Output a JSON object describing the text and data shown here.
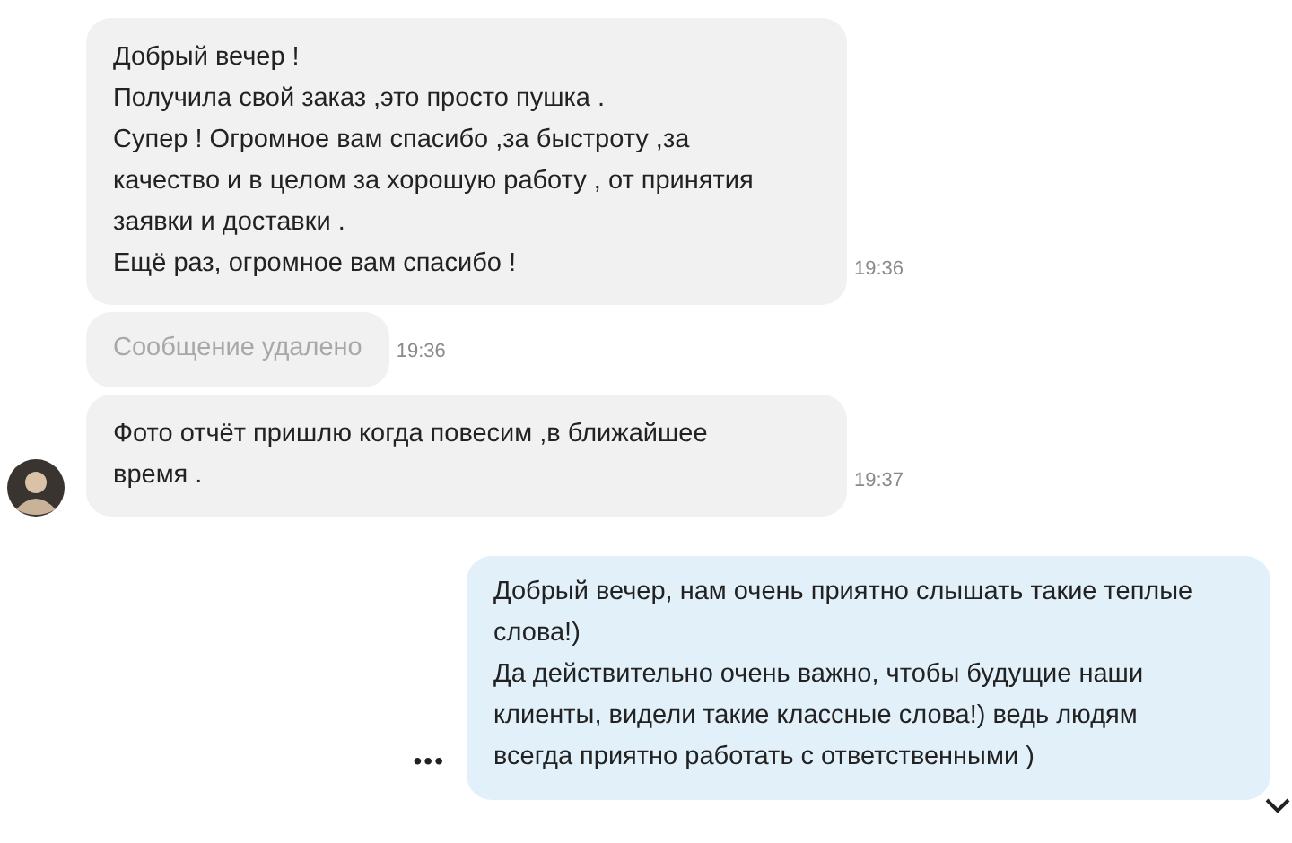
{
  "messages": [
    {
      "kind": "text",
      "avatar": false,
      "lines": [
        "Добрый вечер !",
        "Получила свой заказ ,это просто пушка .",
        "Супер ! Огромное вам спасибо ,за быстроту ,за",
        "качество и в целом за хорошую работу , от принятия",
        "заявки и доставки .",
        "Ещё раз, огромное вам спасибо !"
      ],
      "time": "19:36"
    },
    {
      "kind": "deleted",
      "avatar": false,
      "lines": [
        "Сообщение удалено"
      ],
      "time": "19:36"
    },
    {
      "kind": "text",
      "avatar": true,
      "lines": [
        "Фото отчёт пришлю когда повесим ,в ближайшее",
        "время ."
      ],
      "time": "19:37"
    },
    {
      "kind": "outgoing",
      "lines": [
        "Добрый вечер, нам очень приятно слышать такие теплые",
        "слова!)",
        "Да действительно очень важно, чтобы будущие наши",
        "клиенты, видели такие классные слова!) ведь людям",
        "всегда приятно работать с  ответственными )"
      ],
      "more": "•••"
    }
  ]
}
